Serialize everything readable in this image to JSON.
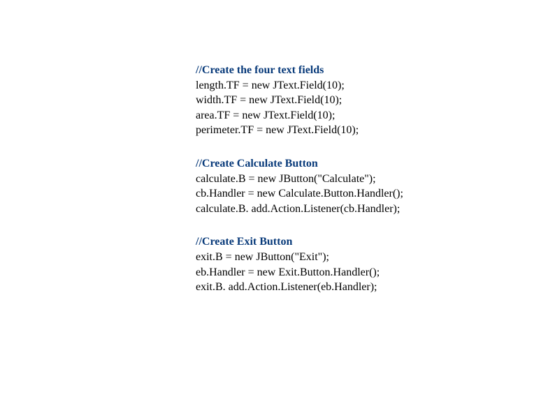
{
  "block1": {
    "comment": "//Create the four text fields",
    "l1": "length.TF = new JText.Field(10);",
    "l2": "width.TF = new JText.Field(10);",
    "l3": "area.TF = new JText.Field(10);",
    "l4": "perimeter.TF = new JText.Field(10);"
  },
  "block2": {
    "comment": "//Create Calculate Button",
    "l1": "calculate.B = new JButton(\"Calculate\");",
    "l2": "cb.Handler = new Calculate.Button.Handler();",
    "l3": " calculate.B. add.Action.Listener(cb.Handler);"
  },
  "block3": {
    "comment": "//Create Exit Button",
    "l1": "exit.B = new JButton(\"Exit\");",
    "l2": "eb.Handler = new Exit.Button.Handler();",
    "l3": "exit.B. add.Action.Listener(eb.Handler);"
  }
}
